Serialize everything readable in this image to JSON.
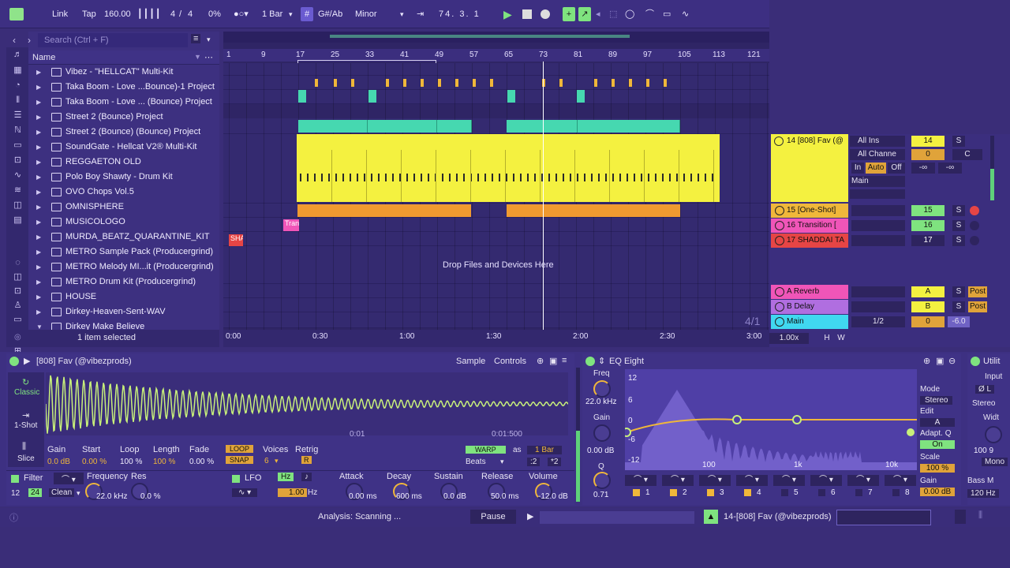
{
  "transport": {
    "link": "Link",
    "tap": "Tap",
    "tempo": "160.00",
    "signature_num": "4",
    "signature_sep": "/",
    "signature_den": "4",
    "cpu": "0%",
    "quantize": "1 Bar",
    "key": "G#/Ab",
    "scale": "Minor",
    "position": "74.  3.  1"
  },
  "browser": {
    "search_placeholder": "Search (Ctrl + F)",
    "header": "Name",
    "items": [
      {
        "label": "Vibez - \"HELLCAT\" Multi-Kit"
      },
      {
        "label": "Taka Boom - Love ...Bounce)-1 Project"
      },
      {
        "label": "Taka Boom - Love ... (Bounce) Project"
      },
      {
        "label": "Street 2 (Bounce) Project"
      },
      {
        "label": "Street 2 (Bounce) (Bounce) Project"
      },
      {
        "label": "SoundGate - Hellcat V2® Multi-Kit"
      },
      {
        "label": "REGGAETON OLD"
      },
      {
        "label": "Polo Boy Shawty - Drum Kit"
      },
      {
        "label": "OVO Chops Vol.5"
      },
      {
        "label": "OMNISPHERE"
      },
      {
        "label": "MUSICOLOGO"
      },
      {
        "label": "MURDA_BEATZ_QUARANTINE_KIT"
      },
      {
        "label": "METRO Sample Pack (Producergrind)"
      },
      {
        "label": "METRO Melody MI...it (Producergrind)"
      },
      {
        "label": "METRO Drum Kit (Producergrind)"
      },
      {
        "label": "HOUSE"
      },
      {
        "label": "Dirkey-Heaven-Sent-WAV"
      },
      {
        "label": "Dirkey Make Believe"
      }
    ],
    "selected_status": "1 item selected"
  },
  "ruler": {
    "bars": [
      "1",
      "9",
      "17",
      "25",
      "33",
      "41",
      "49",
      "57",
      "65",
      "73",
      "81",
      "89",
      "97",
      "105",
      "113",
      "121"
    ],
    "times": [
      "0:00",
      "0:30",
      "1:00",
      "1:30",
      "2:00",
      "2:30",
      "3:00"
    ]
  },
  "arrangement": {
    "drop_hint": "Drop Files and Devices Here",
    "signature_marker": "4/1",
    "clip_tran": "Tran",
    "clip_sha": "SHA"
  },
  "mixer": {
    "track14": {
      "name": "14 [808] Fav (@",
      "input": "All Ins",
      "channel": "All Channe",
      "in": "In",
      "auto": "Auto",
      "off": "Off",
      "out": "Main",
      "num": "14",
      "s": "S",
      "pan": "0",
      "c": "C",
      "vol1": "-∞",
      "vol2": "-∞"
    },
    "track15": {
      "name": "15 [One-Shot]",
      "num": "15",
      "s": "S"
    },
    "track16": {
      "name": "16 Transition [",
      "num": "16",
      "s": "S"
    },
    "track17": {
      "name": "17 SHADDAI TA",
      "num": "17",
      "s": "S"
    },
    "returnA": {
      "name": "A Reverb",
      "num": "A",
      "s": "S",
      "post": "Post"
    },
    "returnB": {
      "name": "B Delay",
      "num": "B",
      "s": "S",
      "post": "Post"
    },
    "main": {
      "name": "Main",
      "sel": "1/2",
      "num": "0",
      "vol": "-6.0"
    },
    "zoom": "1.00x",
    "h": "H",
    "w": "W"
  },
  "sampler": {
    "title": "[808] Fav (@vibezprods)",
    "tab_sample": "Sample",
    "tab_controls": "Controls",
    "mode_classic": "Classic",
    "mode_1shot": "1-Shot",
    "mode_slice": "Slice",
    "time1": "0:01",
    "time2": "0:01:500",
    "params": [
      {
        "label": "Gain",
        "value": "0.0 dB"
      },
      {
        "label": "Start",
        "value": "0.00 %"
      },
      {
        "label": "Loop",
        "value": "100 %"
      },
      {
        "label": "Length",
        "value": "100 %"
      },
      {
        "label": "Fade",
        "value": "0.00 %"
      }
    ],
    "loop": "LOOP",
    "snap": "SNAP",
    "voices_label": "Voices",
    "voices": "6",
    "retrig": "Retrig",
    "retrig_val": "R",
    "warp": "WARP",
    "as": "as",
    "bar": "1 Bar",
    "beats": "Beats",
    "half": ":2",
    "dbl": "*2",
    "filter": "Filter",
    "f12": "12",
    "f24": "24",
    "clean": "Clean",
    "freq_label": "Frequency",
    "freq": "22.0 kHz",
    "res_label": "Res",
    "res": "0.0 %",
    "lfo": "LFO",
    "hz": "Hz",
    "lfo_rate": "1.00",
    "lfo_unit": "Hz",
    "env": [
      {
        "label": "Attack",
        "value": "0.00 ms"
      },
      {
        "label": "Decay",
        "value": "600 ms"
      },
      {
        "label": "Sustain",
        "value": "0.0 dB"
      },
      {
        "label": "Release",
        "value": "50.0 ms"
      },
      {
        "label": "Volume",
        "value": "-12.0 dB"
      }
    ]
  },
  "eq": {
    "title": "EQ Eight",
    "freq_label": "Freq",
    "freq": "22.0 kHz",
    "gain_label": "Gain",
    "gain": "0.00 dB",
    "q_label": "Q",
    "q": "0.71",
    "db": [
      "12",
      "6",
      "0",
      "-6",
      "-12"
    ],
    "hz": [
      "100",
      "1k",
      "10k"
    ],
    "bands": [
      "1",
      "2",
      "3",
      "4",
      "5",
      "6",
      "7",
      "8"
    ],
    "mode_label": "Mode",
    "mode": "Stereo",
    "edit_label": "Edit",
    "edit": "A",
    "adapt": "Adapt. Q",
    "on": "On",
    "scale_label": "Scale",
    "scale": "100 %",
    "gain2_label": "Gain",
    "gain2": "0.00 dB"
  },
  "utility": {
    "title": "Utilit",
    "input": "Input",
    "l": "Ø L",
    "stereo": "Stereo",
    "width": "Widt",
    "w100": "100 9",
    "mono": "Mono",
    "bass": "Bass M",
    "hz": "120 Hz"
  },
  "status": {
    "analysis": "Analysis: Scanning ...",
    "pause": "Pause",
    "track": "14-[808] Fav (@vibezprods)"
  }
}
